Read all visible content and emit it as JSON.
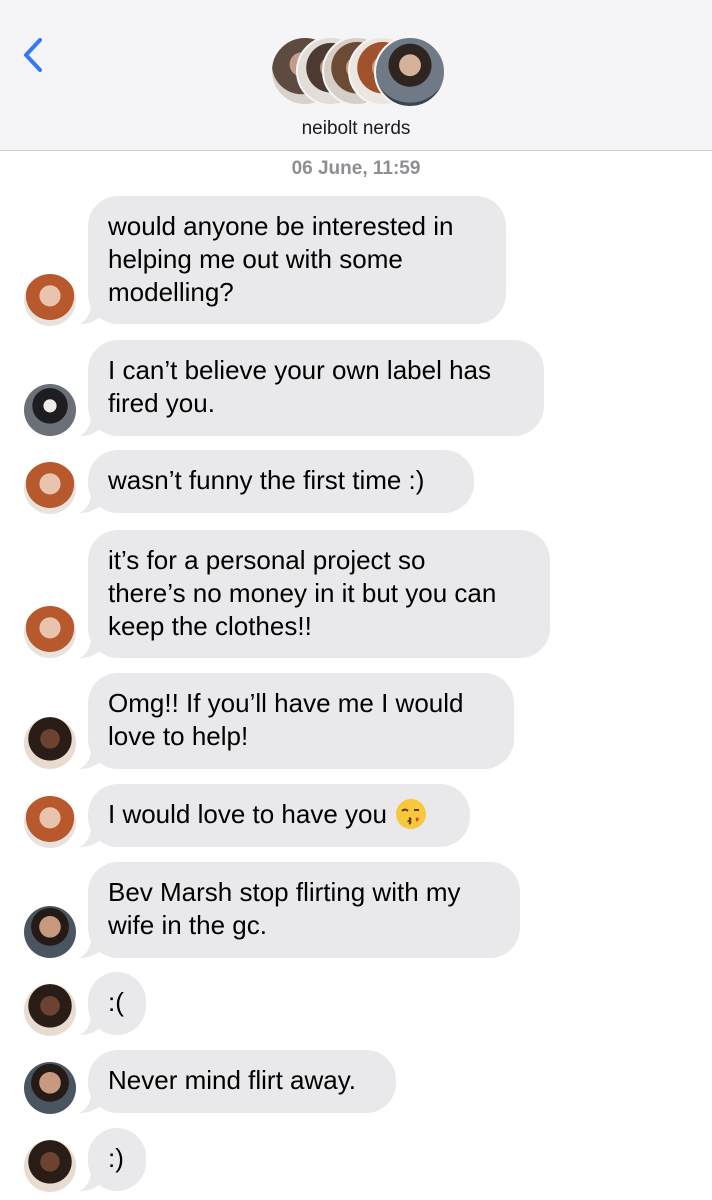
{
  "header": {
    "back_icon": "chevron-left-icon",
    "group_name": "neibolt nerds",
    "accent_color": "#3478f6"
  },
  "timestamp": {
    "date": "06 June,",
    "time": "11:59"
  },
  "messages": [
    {
      "sender": "redhead",
      "lines": [
        "would anyone be interested in",
        "helping me out with some",
        "modelling?"
      ]
    },
    {
      "sender": "dark-hair-man",
      "lines": [
        "I can’t believe your own label has",
        "fired you."
      ]
    },
    {
      "sender": "redhead",
      "lines": [
        "wasn’t funny the first time :)"
      ]
    },
    {
      "sender": "redhead",
      "lines": [
        "it’s for a personal project so",
        "there’s no money in it but you can",
        "keep the clothes!!"
      ]
    },
    {
      "sender": "braids",
      "lines": [
        "Omg!! If you’ll have me I would",
        "love to help!"
      ]
    },
    {
      "sender": "redhead",
      "lines": [
        "I would love to have you"
      ],
      "emoji": "kissing-face-emoji"
    },
    {
      "sender": "bearded-man",
      "lines": [
        "Bev Marsh stop flirting with my",
        "wife in the gc."
      ]
    },
    {
      "sender": "braids",
      "lines": [
        ":("
      ]
    },
    {
      "sender": "bearded-man",
      "lines": [
        "Never mind flirt away."
      ]
    },
    {
      "sender": "braids",
      "lines": [
        ":)"
      ]
    }
  ],
  "colors": {
    "bubble_bg": "#e9e9eb",
    "timestamp": "#8e8e93",
    "header_bg": "#f5f5f7"
  }
}
